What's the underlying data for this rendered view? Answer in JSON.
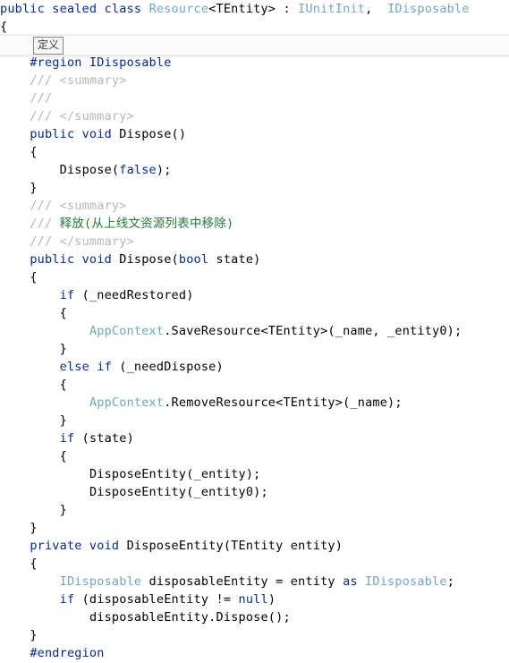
{
  "editor": {
    "language": "csharp",
    "colors": {
      "background": "#ffffff",
      "keyword": "#00299c",
      "type": "#6fa8bb",
      "plain": "#000000",
      "comment_tag": "#b7b7b7",
      "comment_text": "#1f7a37",
      "preprocessor": "#00299c",
      "tooltip_border": "#878787",
      "tooltip_background": "#f6f6f6",
      "highlight_band": "#ededf0"
    }
  },
  "tooltip": {
    "name": "collapsed-region-definition-tooltip",
    "label": "定义"
  },
  "lines": [
    {
      "indent": 0,
      "tokens": [
        {
          "t": "public sealed class ",
          "c": "kw"
        },
        {
          "t": "Resource",
          "c": "type"
        },
        {
          "t": "<TEntity> : ",
          "c": "plain"
        },
        {
          "t": "IUnitInit",
          "c": "type"
        },
        {
          "t": ",  ",
          "c": "plain"
        },
        {
          "t": "IDisposable",
          "c": "type"
        }
      ]
    },
    {
      "indent": 0,
      "tokens": [
        {
          "t": "{",
          "c": "plain"
        }
      ]
    },
    {
      "indent": 0,
      "tokens": [
        {
          "t": "",
          "c": "plain"
        }
      ]
    },
    {
      "indent": 1,
      "tokens": [
        {
          "t": "#region IDisposable",
          "c": "pp"
        }
      ]
    },
    {
      "indent": 1,
      "tokens": [
        {
          "t": "/// ",
          "c": "cmt"
        },
        {
          "t": "<summary>",
          "c": "cmt"
        }
      ]
    },
    {
      "indent": 1,
      "tokens": [
        {
          "t": "///",
          "c": "cmt"
        }
      ]
    },
    {
      "indent": 1,
      "tokens": [
        {
          "t": "/// ",
          "c": "cmt"
        },
        {
          "t": "</summary>",
          "c": "cmt"
        }
      ]
    },
    {
      "indent": 1,
      "tokens": [
        {
          "t": "public void ",
          "c": "kw"
        },
        {
          "t": "Dispose()",
          "c": "plain"
        }
      ]
    },
    {
      "indent": 1,
      "tokens": [
        {
          "t": "{",
          "c": "plain"
        }
      ]
    },
    {
      "indent": 2,
      "tokens": [
        {
          "t": "Dispose(",
          "c": "plain"
        },
        {
          "t": "false",
          "c": "kw"
        },
        {
          "t": ");",
          "c": "plain"
        }
      ]
    },
    {
      "indent": 1,
      "tokens": [
        {
          "t": "}",
          "c": "plain"
        }
      ]
    },
    {
      "indent": 1,
      "tokens": [
        {
          "t": "/// ",
          "c": "cmt"
        },
        {
          "t": "<summary>",
          "c": "cmt"
        }
      ]
    },
    {
      "indent": 1,
      "tokens": [
        {
          "t": "/// ",
          "c": "cmt"
        },
        {
          "t": "释放(从上线文资源列表中移除)",
          "c": "cmt-txt"
        }
      ]
    },
    {
      "indent": 1,
      "tokens": [
        {
          "t": "/// ",
          "c": "cmt"
        },
        {
          "t": "</summary>",
          "c": "cmt"
        }
      ]
    },
    {
      "indent": 1,
      "tokens": [
        {
          "t": "public void ",
          "c": "kw"
        },
        {
          "t": "Dispose(",
          "c": "plain"
        },
        {
          "t": "bool",
          "c": "kw"
        },
        {
          "t": " state)",
          "c": "plain"
        }
      ]
    },
    {
      "indent": 1,
      "tokens": [
        {
          "t": "{",
          "c": "plain"
        }
      ]
    },
    {
      "indent": 2,
      "tokens": [
        {
          "t": "if",
          "c": "kw"
        },
        {
          "t": " (_needRestored)",
          "c": "plain"
        }
      ]
    },
    {
      "indent": 2,
      "tokens": [
        {
          "t": "{",
          "c": "plain"
        }
      ]
    },
    {
      "indent": 3,
      "tokens": [
        {
          "t": "AppContext",
          "c": "type"
        },
        {
          "t": ".SaveResource<TEntity>(_name, _entity0);",
          "c": "plain"
        }
      ]
    },
    {
      "indent": 2,
      "tokens": [
        {
          "t": "}",
          "c": "plain"
        }
      ]
    },
    {
      "indent": 2,
      "tokens": [
        {
          "t": "else if",
          "c": "kw"
        },
        {
          "t": " (_needDispose)",
          "c": "plain"
        }
      ]
    },
    {
      "indent": 2,
      "tokens": [
        {
          "t": "{",
          "c": "plain"
        }
      ]
    },
    {
      "indent": 3,
      "tokens": [
        {
          "t": "AppContext",
          "c": "type"
        },
        {
          "t": ".RemoveResource<TEntity>(_name);",
          "c": "plain"
        }
      ]
    },
    {
      "indent": 2,
      "tokens": [
        {
          "t": "}",
          "c": "plain"
        }
      ]
    },
    {
      "indent": 2,
      "tokens": [
        {
          "t": "if",
          "c": "kw"
        },
        {
          "t": " (state)",
          "c": "plain"
        }
      ]
    },
    {
      "indent": 2,
      "tokens": [
        {
          "t": "{",
          "c": "plain"
        }
      ]
    },
    {
      "indent": 3,
      "tokens": [
        {
          "t": "DisposeEntity(_entity);",
          "c": "plain"
        }
      ]
    },
    {
      "indent": 3,
      "tokens": [
        {
          "t": "DisposeEntity(_entity0);",
          "c": "plain"
        }
      ]
    },
    {
      "indent": 2,
      "tokens": [
        {
          "t": "}",
          "c": "plain"
        }
      ]
    },
    {
      "indent": 1,
      "tokens": [
        {
          "t": "}",
          "c": "plain"
        }
      ]
    },
    {
      "indent": 1,
      "tokens": [
        {
          "t": "private void ",
          "c": "kw"
        },
        {
          "t": "DisposeEntity(TEntity entity)",
          "c": "plain"
        }
      ]
    },
    {
      "indent": 1,
      "tokens": [
        {
          "t": "{",
          "c": "plain"
        }
      ]
    },
    {
      "indent": 2,
      "tokens": [
        {
          "t": "IDisposable",
          "c": "type"
        },
        {
          "t": " disposableEntity = entity ",
          "c": "plain"
        },
        {
          "t": "as",
          "c": "kw"
        },
        {
          "t": " ",
          "c": "plain"
        },
        {
          "t": "IDisposable",
          "c": "type"
        },
        {
          "t": ";",
          "c": "plain"
        }
      ]
    },
    {
      "indent": 2,
      "tokens": [
        {
          "t": "if",
          "c": "kw"
        },
        {
          "t": " (disposableEntity != ",
          "c": "plain"
        },
        {
          "t": "null",
          "c": "kw"
        },
        {
          "t": ")",
          "c": "plain"
        }
      ]
    },
    {
      "indent": 3,
      "tokens": [
        {
          "t": "disposableEntity.Dispose();",
          "c": "plain"
        }
      ]
    },
    {
      "indent": 1,
      "tokens": [
        {
          "t": "}",
          "c": "plain"
        }
      ]
    },
    {
      "indent": 1,
      "tokens": [
        {
          "t": "#endregion",
          "c": "pp"
        }
      ]
    }
  ]
}
